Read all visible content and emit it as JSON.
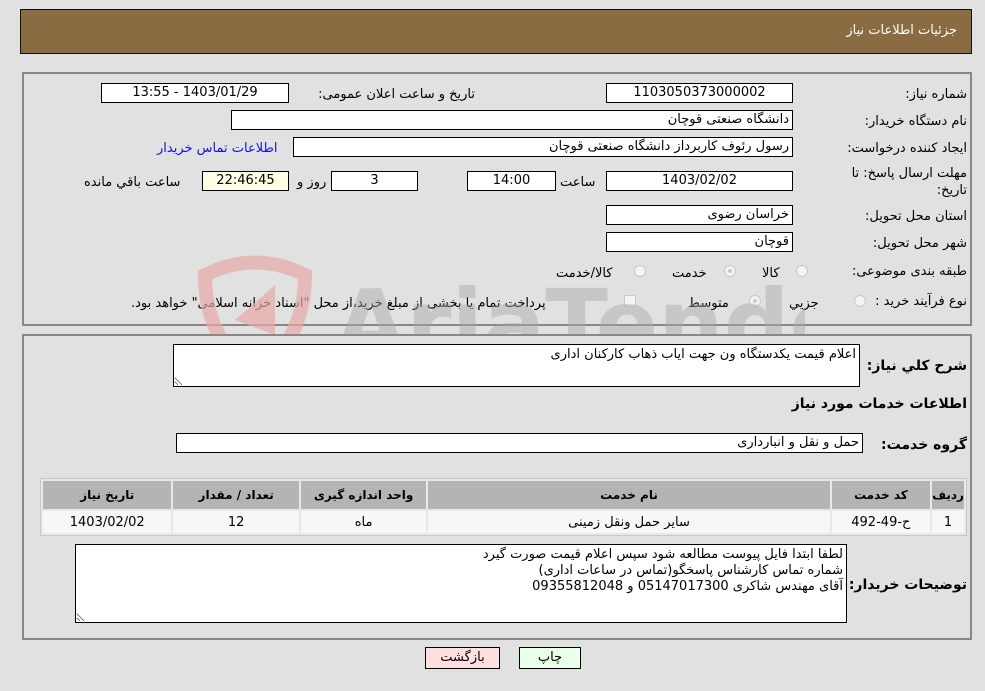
{
  "header": {
    "title": "جزئیات اطلاعات نیاز"
  },
  "form": {
    "need_number": {
      "label": "شماره نیاز:",
      "value": "1103050373000002"
    },
    "announce_datetime": {
      "label": "تاریخ و ساعت اعلان عمومی:",
      "value": "1403/01/29 - 13:55"
    },
    "buyer_org": {
      "label": "نام دستگاه خریدار:",
      "value": "دانشگاه صنعتی قوچان"
    },
    "requester": {
      "label": "ایجاد کننده درخواست:",
      "value": "رسول رئوف کاربرداز دانشگاه صنعتی قوچان"
    },
    "buyer_contact_link": "اطلاعات تماس خریدار",
    "deadline": {
      "label": "مهلت ارسال پاسخ: تا تاریخ:",
      "date": "1403/02/02",
      "time_label": "ساعت",
      "time": "14:00",
      "days": "3",
      "days_label": "روز و",
      "remaining": "22:46:45",
      "remaining_label": "ساعت باقي مانده"
    },
    "province": {
      "label": "استان محل تحویل:",
      "value": "خراسان رضوی"
    },
    "city": {
      "label": "شهر محل تحویل:",
      "value": "قوچان"
    },
    "category": {
      "label": "طبقه بندی موضوعی:",
      "options": [
        {
          "label": "کالا",
          "checked": false
        },
        {
          "label": "خدمت",
          "checked": true
        },
        {
          "label": "کالا/خدمت",
          "checked": false
        }
      ]
    },
    "purchase_process": {
      "label": "نوع فرآیند خرید :",
      "options": [
        {
          "label": "جزيي",
          "checked": false
        },
        {
          "label": "متوسط",
          "checked": true
        }
      ],
      "treasury_note": "پرداخت تمام یا بخشی از مبلغ خرید،از محل \"اسناد خزانه اسلامی\" خواهد بود."
    }
  },
  "details": {
    "description_label": "شرح کلي نياز:",
    "description": "اعلام قیمت یکدستگاه ون جهت ایاب ذهاب کارکنان اداری",
    "services_title": "اطلاعات خدمات مورد نیاز",
    "service_group_label": "گروه خدمت:",
    "service_group": "حمل و نقل و انبارداری",
    "table": {
      "headers": [
        "ردیف",
        "کد خدمت",
        "نام خدمت",
        "واحد اندازه گیری",
        "تعداد / مقدار",
        "تاریخ نیاز"
      ],
      "rows": [
        [
          "1",
          "ح-49-492",
          "سایر حمل ونقل زمینی",
          "ماه",
          "12",
          "1403/02/02"
        ]
      ]
    },
    "buyer_notes_label": "توضیحات خریدار:",
    "buyer_notes": "لطفا ابتدا فایل پیوست مطالعه شود سپس اعلام قیمت صورت گیرد\nشماره تماس کارشناس پاسخگو(تماس در ساعات اداری)\nآقای مهندس شاکری 05147017300 و 09355812048"
  },
  "buttons": {
    "print": "چاپ",
    "back": "بازگشت"
  },
  "watermark": {
    "text": "AriaTender.neT"
  },
  "colors": {
    "header_bg": "#8b6b42",
    "print_bg": "#eaffea",
    "back_bg": "#ffe0e0",
    "link": "#1515d4"
  }
}
